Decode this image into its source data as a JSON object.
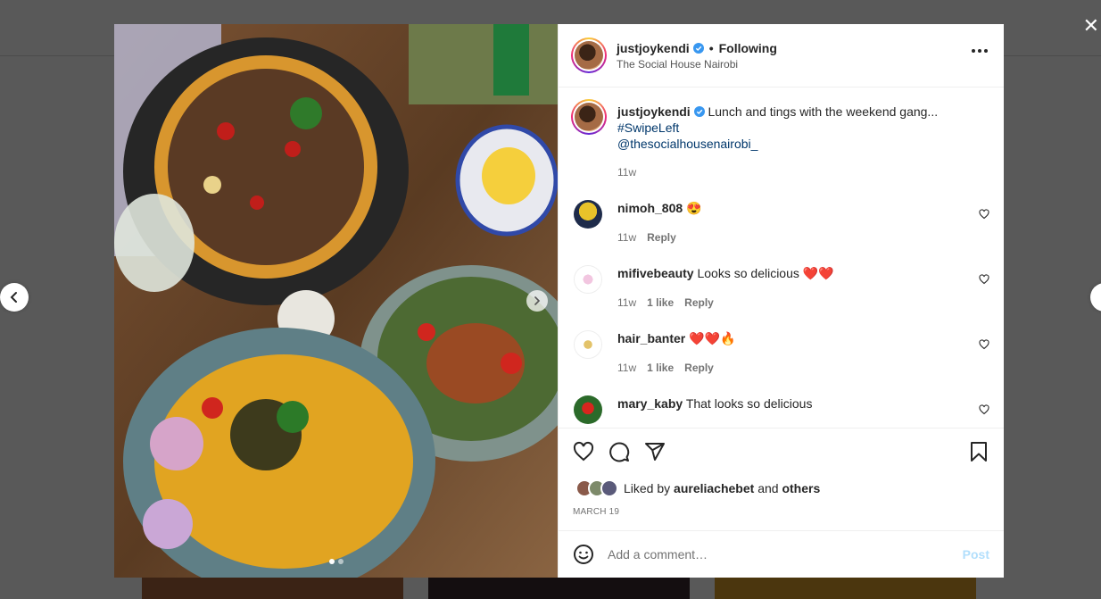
{
  "post": {
    "username": "justjoykendi",
    "follow_status": "Following",
    "location": "The Social House Nairobi",
    "caption_text": "Lunch and tings with the weekend gang...",
    "hashtag": "#SwipeLeft",
    "mention": "@thesocialhousenairobi_",
    "caption_age": "11w",
    "separator": "•"
  },
  "comments": [
    {
      "username": "nimoh_808",
      "text": "😍",
      "age": "11w",
      "likes": "",
      "reply": "Reply"
    },
    {
      "username": "mifivebeauty",
      "text": "Looks so delicious ❤️❤️",
      "age": "11w",
      "likes": "1 like",
      "reply": "Reply"
    },
    {
      "username": "hair_banter",
      "text": "❤️❤️🔥",
      "age": "11w",
      "likes": "1 like",
      "reply": "Reply"
    },
    {
      "username": "mary_kaby",
      "text": "That looks so delicious",
      "age": "",
      "likes": "",
      "reply": ""
    }
  ],
  "likes": {
    "prefix": "Liked by",
    "user": "aureliachebet",
    "conjunction": "and",
    "others": "others"
  },
  "date": "MARCH 19",
  "add_comment": {
    "placeholder": "Add a comment…",
    "post_label": "Post"
  },
  "close_label": "✕",
  "carousel": {
    "slide_count": 2,
    "active_index": 0
  },
  "colors": {
    "link": "#00376b",
    "post_disabled": "#b2dffc",
    "verified": "#3897f0"
  },
  "icons": [
    "heart-icon",
    "comment-icon",
    "share-icon",
    "bookmark-icon",
    "emoji-icon",
    "more-icon",
    "verified-icon",
    "chevron-left-icon",
    "chevron-right-icon"
  ]
}
